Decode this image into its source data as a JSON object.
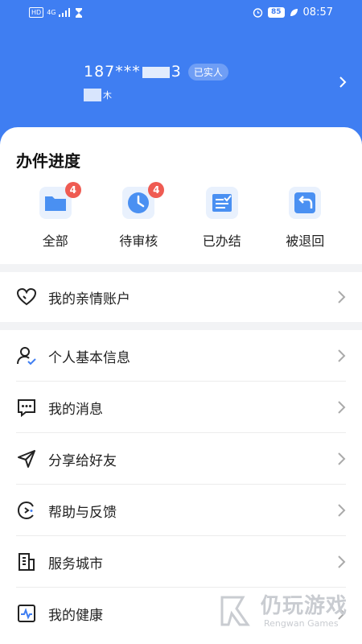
{
  "status_bar": {
    "network_tag": "HD",
    "network_type": "4G",
    "battery": "85",
    "time": "08:57"
  },
  "user": {
    "phone_prefix": "187***",
    "phone_suffix": "3",
    "verified_label": "已实人",
    "nickname_tail": "木"
  },
  "progress": {
    "title": "办件进度",
    "items": [
      {
        "label": "全部",
        "badge": "4",
        "icon": "folder-icon"
      },
      {
        "label": "待审核",
        "badge": "4",
        "icon": "clock-icon"
      },
      {
        "label": "已办结",
        "badge": "",
        "icon": "document-check-icon"
      },
      {
        "label": "被退回",
        "badge": "",
        "icon": "return-arrow-icon"
      }
    ]
  },
  "family": {
    "label": "我的亲情账户",
    "icon": "heart-icon"
  },
  "menu": {
    "items": [
      {
        "label": "个人基本信息",
        "icon": "user-check-icon"
      },
      {
        "label": "我的消息",
        "icon": "message-icon"
      },
      {
        "label": "分享给好友",
        "icon": "share-send-icon"
      },
      {
        "label": "帮助与反馈",
        "icon": "help-feedback-icon"
      },
      {
        "label": "服务城市",
        "icon": "city-building-icon"
      },
      {
        "label": "我的健康",
        "icon": "health-monitor-icon"
      }
    ]
  },
  "watermark": {
    "cn": "仍玩游戏",
    "en": "Rengwan Games"
  },
  "colors": {
    "primary": "#3f7ef2",
    "badge": "#ef5b52",
    "icon_blue": "#4a90f2",
    "background": "#f2f3f5"
  }
}
